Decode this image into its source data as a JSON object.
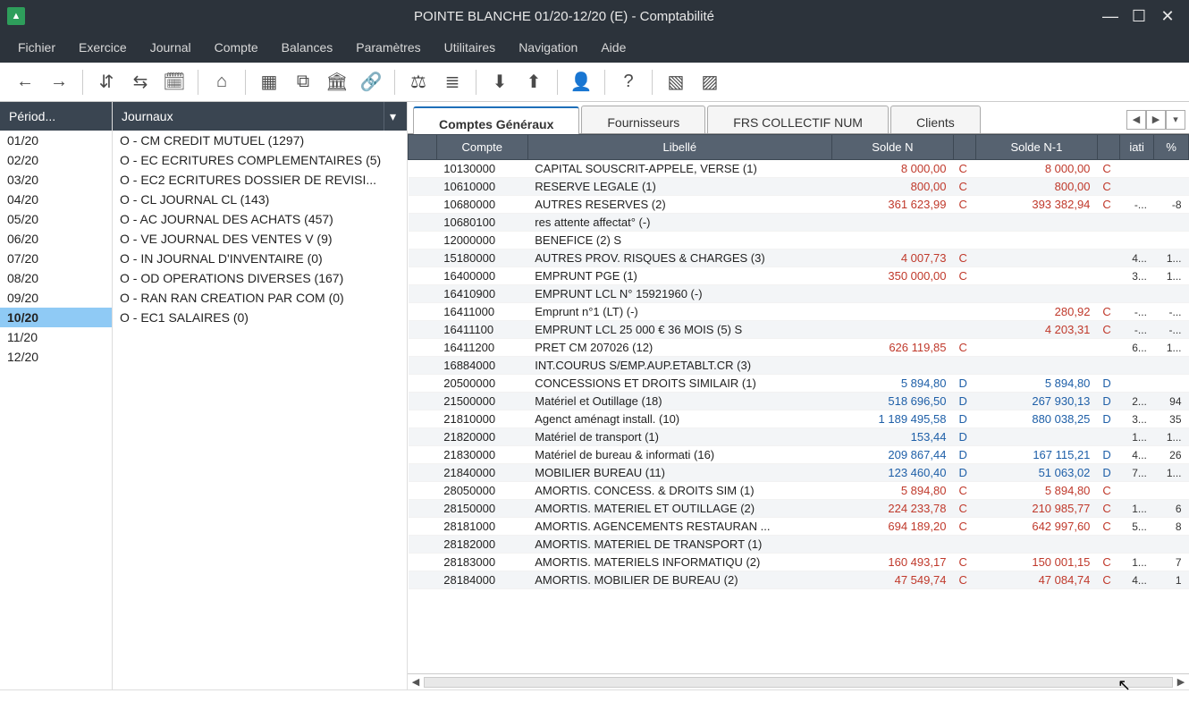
{
  "window": {
    "title": "POINTE BLANCHE 01/20-12/20 (E) - Comptabilité"
  },
  "menu": [
    "Fichier",
    "Exercice",
    "Journal",
    "Compte",
    "Balances",
    "Paramètres",
    "Utilitaires",
    "Navigation",
    "Aide"
  ],
  "toolbar_icons": [
    "back-icon",
    "forward-icon",
    "sep",
    "split-h-icon",
    "split-v-icon",
    "calendar-icon",
    "sep",
    "home-icon",
    "sep",
    "grid-icon",
    "tree-icon",
    "bank-icon",
    "link-icon",
    "sep",
    "balance-icon",
    "list-icon",
    "sep",
    "download-icon",
    "upload-icon",
    "sep",
    "user-icon",
    "sep",
    "help-icon",
    "sep",
    "adnbox-icon",
    "adnbanq-icon"
  ],
  "periods": {
    "header": "Périod...",
    "items": [
      "01/20",
      "02/20",
      "03/20",
      "04/20",
      "05/20",
      "06/20",
      "07/20",
      "08/20",
      "09/20",
      "10/20",
      "11/20",
      "12/20"
    ],
    "selected": "10/20"
  },
  "journals": {
    "header": "Journaux",
    "items": [
      "O - CM CREDIT MUTUEL (1297)",
      "O - EC ECRITURES COMPLEMENTAIRES (5)",
      "O - EC2 ECRITURES DOSSIER DE REVISI...",
      "O - CL JOURNAL CL (143)",
      "O - AC JOURNAL DES ACHATS (457)",
      "O - VE JOURNAL DES VENTES V (9)",
      "O - IN JOURNAL D'INVENTAIRE (0)",
      "O - OD OPERATIONS DIVERSES (167)",
      "O - RAN RAN CREATION PAR COM (0)",
      "O - EC1 SALAIRES (0)"
    ]
  },
  "tabs": {
    "items": [
      "Comptes Généraux",
      "Fournisseurs",
      "FRS COLLECTIF NUM",
      "Clients"
    ],
    "active": 0
  },
  "grid": {
    "headers": [
      "Compte",
      "Libellé",
      "Solde N",
      "",
      "Solde N-1",
      "",
      "iati",
      "%"
    ],
    "rows": [
      {
        "compte": "10130000",
        "lib": "CAPITAL SOUSCRIT-APPELE, VERSE (1)",
        "sn": "8 000,00",
        "snf": "C",
        "sn1": "8 000,00",
        "sn1f": "C",
        "var": "",
        "pct": ""
      },
      {
        "compte": "10610000",
        "lib": "RESERVE LEGALE (1)",
        "sn": "800,00",
        "snf": "C",
        "sn1": "800,00",
        "sn1f": "C",
        "var": "",
        "pct": ""
      },
      {
        "compte": "10680000",
        "lib": "AUTRES RESERVES (2)",
        "sn": "361 623,99",
        "snf": "C",
        "sn1": "393 382,94",
        "sn1f": "C",
        "var": "-...",
        "pct": "-8"
      },
      {
        "compte": "10680100",
        "lib": "res attente affectat° (-)",
        "sn": "",
        "snf": "",
        "sn1": "",
        "sn1f": "",
        "var": "",
        "pct": ""
      },
      {
        "compte": "12000000",
        "lib": "BENEFICE (2) S",
        "sn": "",
        "snf": "",
        "sn1": "",
        "sn1f": "",
        "var": "",
        "pct": ""
      },
      {
        "compte": "15180000",
        "lib": "AUTRES PROV. RISQUES & CHARGES (3)",
        "sn": "4 007,73",
        "snf": "C",
        "sn1": "",
        "sn1f": "",
        "var": "4...",
        "pct": "1..."
      },
      {
        "compte": "16400000",
        "lib": "EMPRUNT PGE (1)",
        "sn": "350 000,00",
        "snf": "C",
        "sn1": "",
        "sn1f": "",
        "var": "3...",
        "pct": "1..."
      },
      {
        "compte": "16410900",
        "lib": "EMPRUNT LCL N° 15921960 (-)",
        "sn": "",
        "snf": "",
        "sn1": "",
        "sn1f": "",
        "var": "",
        "pct": ""
      },
      {
        "compte": "16411000",
        "lib": "Emprunt n°1 (LT) (-)",
        "sn": "",
        "snf": "",
        "sn1": "280,92",
        "sn1f": "C",
        "var": "-...",
        "pct": "-..."
      },
      {
        "compte": "16411100",
        "lib": "EMPRUNT LCL 25 000 € 36 MOIS (5) S",
        "sn": "",
        "snf": "",
        "sn1": "4 203,31",
        "sn1f": "C",
        "var": "-...",
        "pct": "-..."
      },
      {
        "compte": "16411200",
        "lib": "PRET CM 207026 (12)",
        "sn": "626 119,85",
        "snf": "C",
        "sn1": "",
        "sn1f": "",
        "var": "6...",
        "pct": "1..."
      },
      {
        "compte": "16884000",
        "lib": "INT.COURUS S/EMP.AUP.ETABLT.CR (3)",
        "sn": "",
        "snf": "",
        "sn1": "",
        "sn1f": "",
        "var": "",
        "pct": ""
      },
      {
        "compte": "20500000",
        "lib": "CONCESSIONS ET DROITS SIMILAIR (1)",
        "sn": "5 894,80",
        "snf": "D",
        "sn1": "5 894,80",
        "sn1f": "D",
        "var": "",
        "pct": ""
      },
      {
        "compte": "21500000",
        "lib": "Matériel et Outillage (18)",
        "sn": "518 696,50",
        "snf": "D",
        "sn1": "267 930,13",
        "sn1f": "D",
        "var": "2...",
        "pct": "94"
      },
      {
        "compte": "21810000",
        "lib": "Agenct aménagt install. (10)",
        "sn": "1 189 495,58",
        "snf": "D",
        "sn1": "880 038,25",
        "sn1f": "D",
        "var": "3...",
        "pct": "35"
      },
      {
        "compte": "21820000",
        "lib": "Matériel de transport (1)",
        "sn": "153,44",
        "snf": "D",
        "sn1": "",
        "sn1f": "",
        "var": "1...",
        "pct": "1..."
      },
      {
        "compte": "21830000",
        "lib": "Matériel de bureau & informati (16)",
        "sn": "209 867,44",
        "snf": "D",
        "sn1": "167 115,21",
        "sn1f": "D",
        "var": "4...",
        "pct": "26"
      },
      {
        "compte": "21840000",
        "lib": "MOBILIER BUREAU (11)",
        "sn": "123 460,40",
        "snf": "D",
        "sn1": "51 063,02",
        "sn1f": "D",
        "var": "7...",
        "pct": "1..."
      },
      {
        "compte": "28050000",
        "lib": "AMORTIS. CONCESS. & DROITS SIM (1)",
        "sn": "5 894,80",
        "snf": "C",
        "sn1": "5 894,80",
        "sn1f": "C",
        "var": "",
        "pct": ""
      },
      {
        "compte": "28150000",
        "lib": "AMORTIS. MATERIEL ET OUTILLAGE (2)",
        "sn": "224 233,78",
        "snf": "C",
        "sn1": "210 985,77",
        "sn1f": "C",
        "var": "1...",
        "pct": "6"
      },
      {
        "compte": "28181000",
        "lib": "AMORTIS. AGENCEMENTS RESTAURAN ...",
        "sn": "694 189,20",
        "snf": "C",
        "sn1": "642 997,60",
        "sn1f": "C",
        "var": "5...",
        "pct": "8"
      },
      {
        "compte": "28182000",
        "lib": "AMORTIS. MATERIEL DE TRANSPORT (1)",
        "sn": "",
        "snf": "",
        "sn1": "",
        "sn1f": "",
        "var": "",
        "pct": ""
      },
      {
        "compte": "28183000",
        "lib": "AMORTIS. MATERIELS INFORMATIQU (2)",
        "sn": "160 493,17",
        "snf": "C",
        "sn1": "150 001,15",
        "sn1f": "C",
        "var": "1...",
        "pct": "7"
      },
      {
        "compte": "28184000",
        "lib": "AMORTIS. MOBILIER DE BUREAU (2)",
        "sn": "47 549,74",
        "snf": "C",
        "sn1": "47 084,74",
        "sn1f": "C",
        "var": "4...",
        "pct": "1"
      }
    ]
  }
}
